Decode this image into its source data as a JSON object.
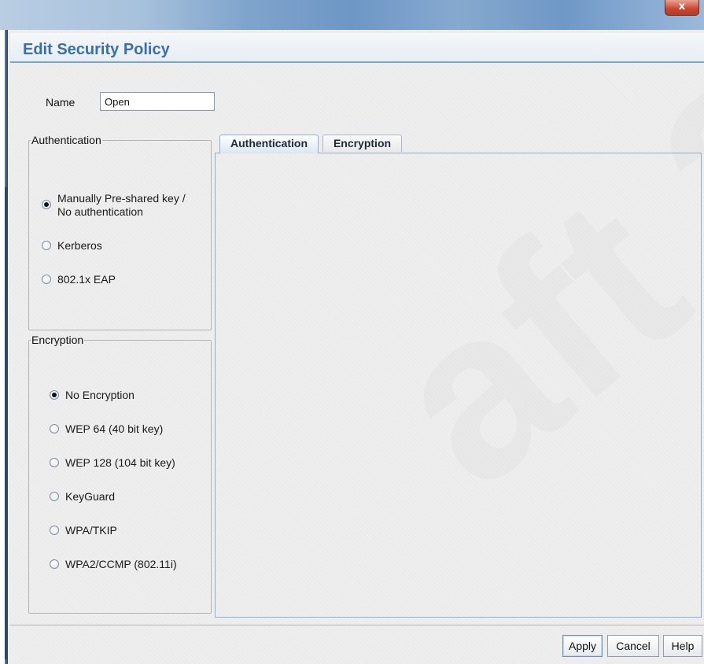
{
  "window": {
    "close_glyph": "x"
  },
  "dialog": {
    "title": "Edit Security Policy"
  },
  "name_field": {
    "label": "Name",
    "value": "Open"
  },
  "authentication": {
    "legend": "Authentication",
    "options": [
      {
        "line1": "Manually Pre-shared key /",
        "line2": "No authentication",
        "selected": true
      },
      {
        "label": "Kerberos",
        "selected": false
      },
      {
        "label": "802.1x EAP",
        "selected": false
      }
    ]
  },
  "encryption": {
    "legend": "Encryption",
    "options": [
      {
        "label": "No Encryption",
        "selected": true
      },
      {
        "label": "WEP 64 (40 bit key)",
        "selected": false
      },
      {
        "label": "WEP 128 (104 bit key)",
        "selected": false
      },
      {
        "label": "KeyGuard",
        "selected": false
      },
      {
        "label": "WPA/TKIP",
        "selected": false
      },
      {
        "label": "WPA2/CCMP (802.11i)",
        "selected": false
      }
    ]
  },
  "tabs": [
    {
      "label": "Authentication",
      "active": true
    },
    {
      "label": "Encryption",
      "active": false
    }
  ],
  "buttons": {
    "apply": "Apply",
    "cancel": "Cancel",
    "help": "Help"
  },
  "colors": {
    "title_text": "#3a6fa8",
    "accent_border": "#7aa6c8",
    "close_button": "#c7462f"
  }
}
